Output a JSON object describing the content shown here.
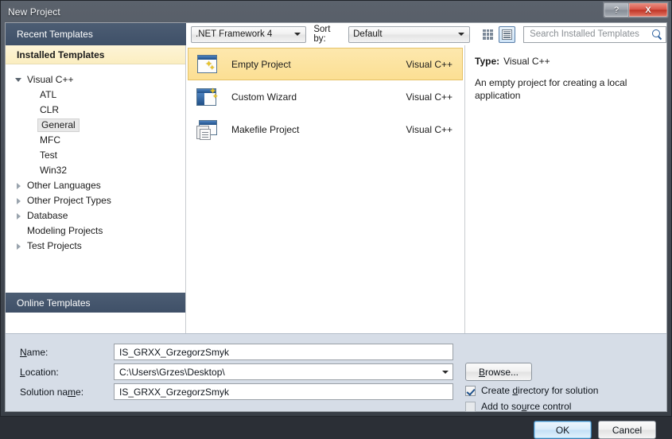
{
  "window": {
    "title": "New Project",
    "help_button": "?",
    "close_button": "X"
  },
  "toolbar": {
    "recent_templates_tab": "Recent Templates",
    "framework_combo": ".NET Framework 4",
    "sort_by_label": "Sort by:",
    "sort_combo": "Default",
    "view_small_icons": "small-icons-view",
    "view_medium_icons": "medium-icons-view",
    "search_placeholder": "Search Installed Templates"
  },
  "left_pane": {
    "installed_templates_header": "Installed Templates",
    "online_templates": "Online Templates",
    "tree": [
      {
        "label": "Visual C++",
        "level": 0,
        "expander": "open",
        "selected": false
      },
      {
        "label": "ATL",
        "level": 1,
        "expander": "none",
        "selected": false
      },
      {
        "label": "CLR",
        "level": 1,
        "expander": "none",
        "selected": false
      },
      {
        "label": "General",
        "level": 1,
        "expander": "none",
        "selected": true
      },
      {
        "label": "MFC",
        "level": 1,
        "expander": "none",
        "selected": false
      },
      {
        "label": "Test",
        "level": 1,
        "expander": "none",
        "selected": false
      },
      {
        "label": "Win32",
        "level": 1,
        "expander": "none",
        "selected": false
      },
      {
        "label": "Other Languages",
        "level": 0,
        "expander": "closed",
        "selected": false
      },
      {
        "label": "Other Project Types",
        "level": 0,
        "expander": "closed",
        "selected": false
      },
      {
        "label": "Database",
        "level": 0,
        "expander": "closed",
        "selected": false
      },
      {
        "label": "Modeling Projects",
        "level": 0,
        "expander": "none",
        "selected": false
      },
      {
        "label": "Test Projects",
        "level": 0,
        "expander": "closed",
        "selected": false
      }
    ]
  },
  "templates": [
    {
      "name": "Empty Project",
      "language": "Visual C++",
      "icon": "empty-project-icon",
      "selected": true
    },
    {
      "name": "Custom Wizard",
      "language": "Visual C++",
      "icon": "custom-wizard-icon",
      "selected": false
    },
    {
      "name": "Makefile Project",
      "language": "Visual C++",
      "icon": "makefile-project-icon",
      "selected": false
    }
  ],
  "details": {
    "type_label": "Type:",
    "type_value": "Visual C++",
    "description": "An empty project for creating a local application"
  },
  "form": {
    "name_label": "Name:",
    "name_value": "IS_GRXX_GrzegorzSmyk",
    "location_label": "Location:",
    "location_value": "C:\\Users\\Grzes\\Desktop\\",
    "solution_name_label": "Solution name:",
    "solution_name_value": "IS_GRXX_GrzegorzSmyk",
    "browse_button": "Browse...",
    "create_directory_checkbox": "Create directory for solution",
    "create_directory_checked": true,
    "add_source_control_checkbox": "Add to source control",
    "add_source_control_checked": false
  },
  "footer": {
    "ok_button": "OK",
    "cancel_button": "Cancel"
  },
  "colors": {
    "accent_blue": "#41536b",
    "selection_yellow": "#fcdf93",
    "installed_header": "#fbeec0",
    "form_background": "#d6dde7",
    "close_red": "#bf3527"
  }
}
